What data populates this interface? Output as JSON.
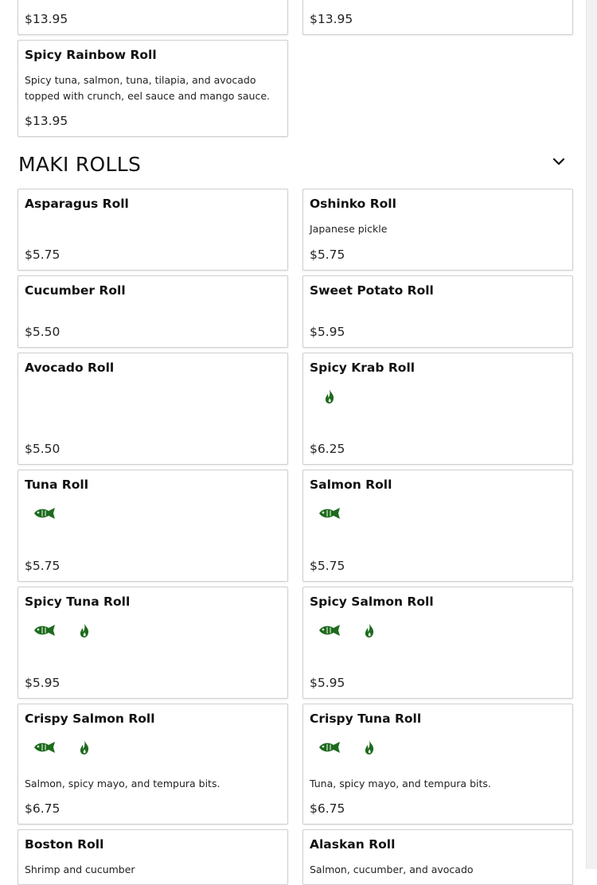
{
  "colors": {
    "icon_green": "#1d6b1d",
    "border": "#cfcfcf"
  },
  "top_cards": {
    "left_price": "$13.95",
    "right_price": "$13.95",
    "spicy_rainbow": {
      "name": "Spicy Rainbow Roll",
      "description": "Spicy tuna, salmon, tuna, tilapia, and avocado topped with crunch, eel sauce and mango sauce.",
      "price": "$13.95"
    }
  },
  "section": {
    "title": "MAKI ROLLS",
    "toggle_icon": "chevron-down-icon"
  },
  "items": [
    {
      "name": "Asparagus Roll",
      "price": "$5.75"
    },
    {
      "name": "Oshinko Roll",
      "description": "Japanese pickle",
      "price": "$5.75"
    },
    {
      "name": "Cucumber Roll",
      "price": "$5.50"
    },
    {
      "name": "Sweet Potato Roll",
      "price": "$5.95"
    },
    {
      "name": "Avocado Roll",
      "price": "$5.50"
    },
    {
      "name": "Spicy Krab Roll",
      "icons": [
        "spicy-icon"
      ],
      "price": "$6.25"
    },
    {
      "name": "Tuna Roll",
      "icons": [
        "raw-fish-icon"
      ],
      "price": "$5.75"
    },
    {
      "name": "Salmon Roll",
      "icons": [
        "raw-fish-icon"
      ],
      "price": "$5.75"
    },
    {
      "name": "Spicy Tuna Roll",
      "icons": [
        "raw-fish-icon",
        "spicy-icon"
      ],
      "price": "$5.95"
    },
    {
      "name": "Spicy Salmon Roll",
      "icons": [
        "raw-fish-icon",
        "spicy-icon"
      ],
      "price": "$5.95"
    },
    {
      "name": "Crispy Salmon Roll",
      "icons": [
        "raw-fish-icon",
        "spicy-icon"
      ],
      "description": "Salmon, spicy mayo, and tempura bits.",
      "price": "$6.75"
    },
    {
      "name": "Crispy Tuna Roll",
      "icons": [
        "raw-fish-icon",
        "spicy-icon"
      ],
      "description": "Tuna, spicy mayo, and tempura bits.",
      "price": "$6.75"
    },
    {
      "name": "Boston Roll",
      "description": "Shrimp and cucumber"
    },
    {
      "name": "Alaskan Roll",
      "description": "Salmon, cucumber, and avocado"
    }
  ]
}
